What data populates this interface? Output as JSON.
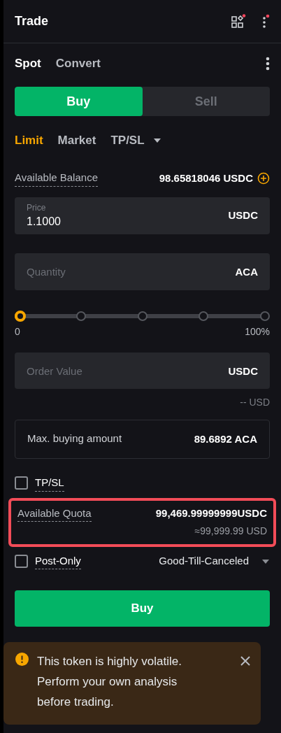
{
  "header": {
    "title": "Trade",
    "icons": [
      {
        "kind": "apps",
        "alert": true
      },
      {
        "kind": "more",
        "alert": true
      }
    ]
  },
  "market_tabs": [
    {
      "label": "Spot",
      "selected": true
    },
    {
      "label": "Convert",
      "selected": false
    }
  ],
  "side_tabs": [
    {
      "label": "Buy",
      "selected": true
    },
    {
      "label": "Sell",
      "selected": false
    }
  ],
  "order_types": [
    {
      "label": "Limit",
      "selected": true,
      "dropdown": false
    },
    {
      "label": "Market",
      "selected": false,
      "dropdown": false
    },
    {
      "label": "TP/SL",
      "selected": false,
      "dropdown": true
    }
  ],
  "balance": {
    "label": "Available Balance",
    "value": "98.65818046 USDC"
  },
  "price_field": {
    "label": "Price",
    "value": "1.1000",
    "unit": "USDC"
  },
  "quantity_field": {
    "placeholder": "Quantity",
    "unit": "ACA"
  },
  "slider": {
    "level": 0,
    "min_label": "0",
    "max_label": "100%"
  },
  "order_value_field": {
    "placeholder": "Order Value",
    "unit": "USDC"
  },
  "order_value_usd": "-- USD",
  "max_buy": {
    "label": "Max. buying amount",
    "value": "89.6892 ACA"
  },
  "tpsl": {
    "label": "TP/SL",
    "checked": false
  },
  "quota": {
    "label": "Available Quota",
    "value": "99,469.99999999USDC",
    "usd": "≈99,999.99 USD",
    "highlighted": true
  },
  "post_only": {
    "label": "Post-Only",
    "checked": false
  },
  "time_in_force": "Good-Till-Canceled",
  "submit": "Buy",
  "toast": {
    "message": "This token is highly volatile. Perform your own analysis before trading."
  }
}
